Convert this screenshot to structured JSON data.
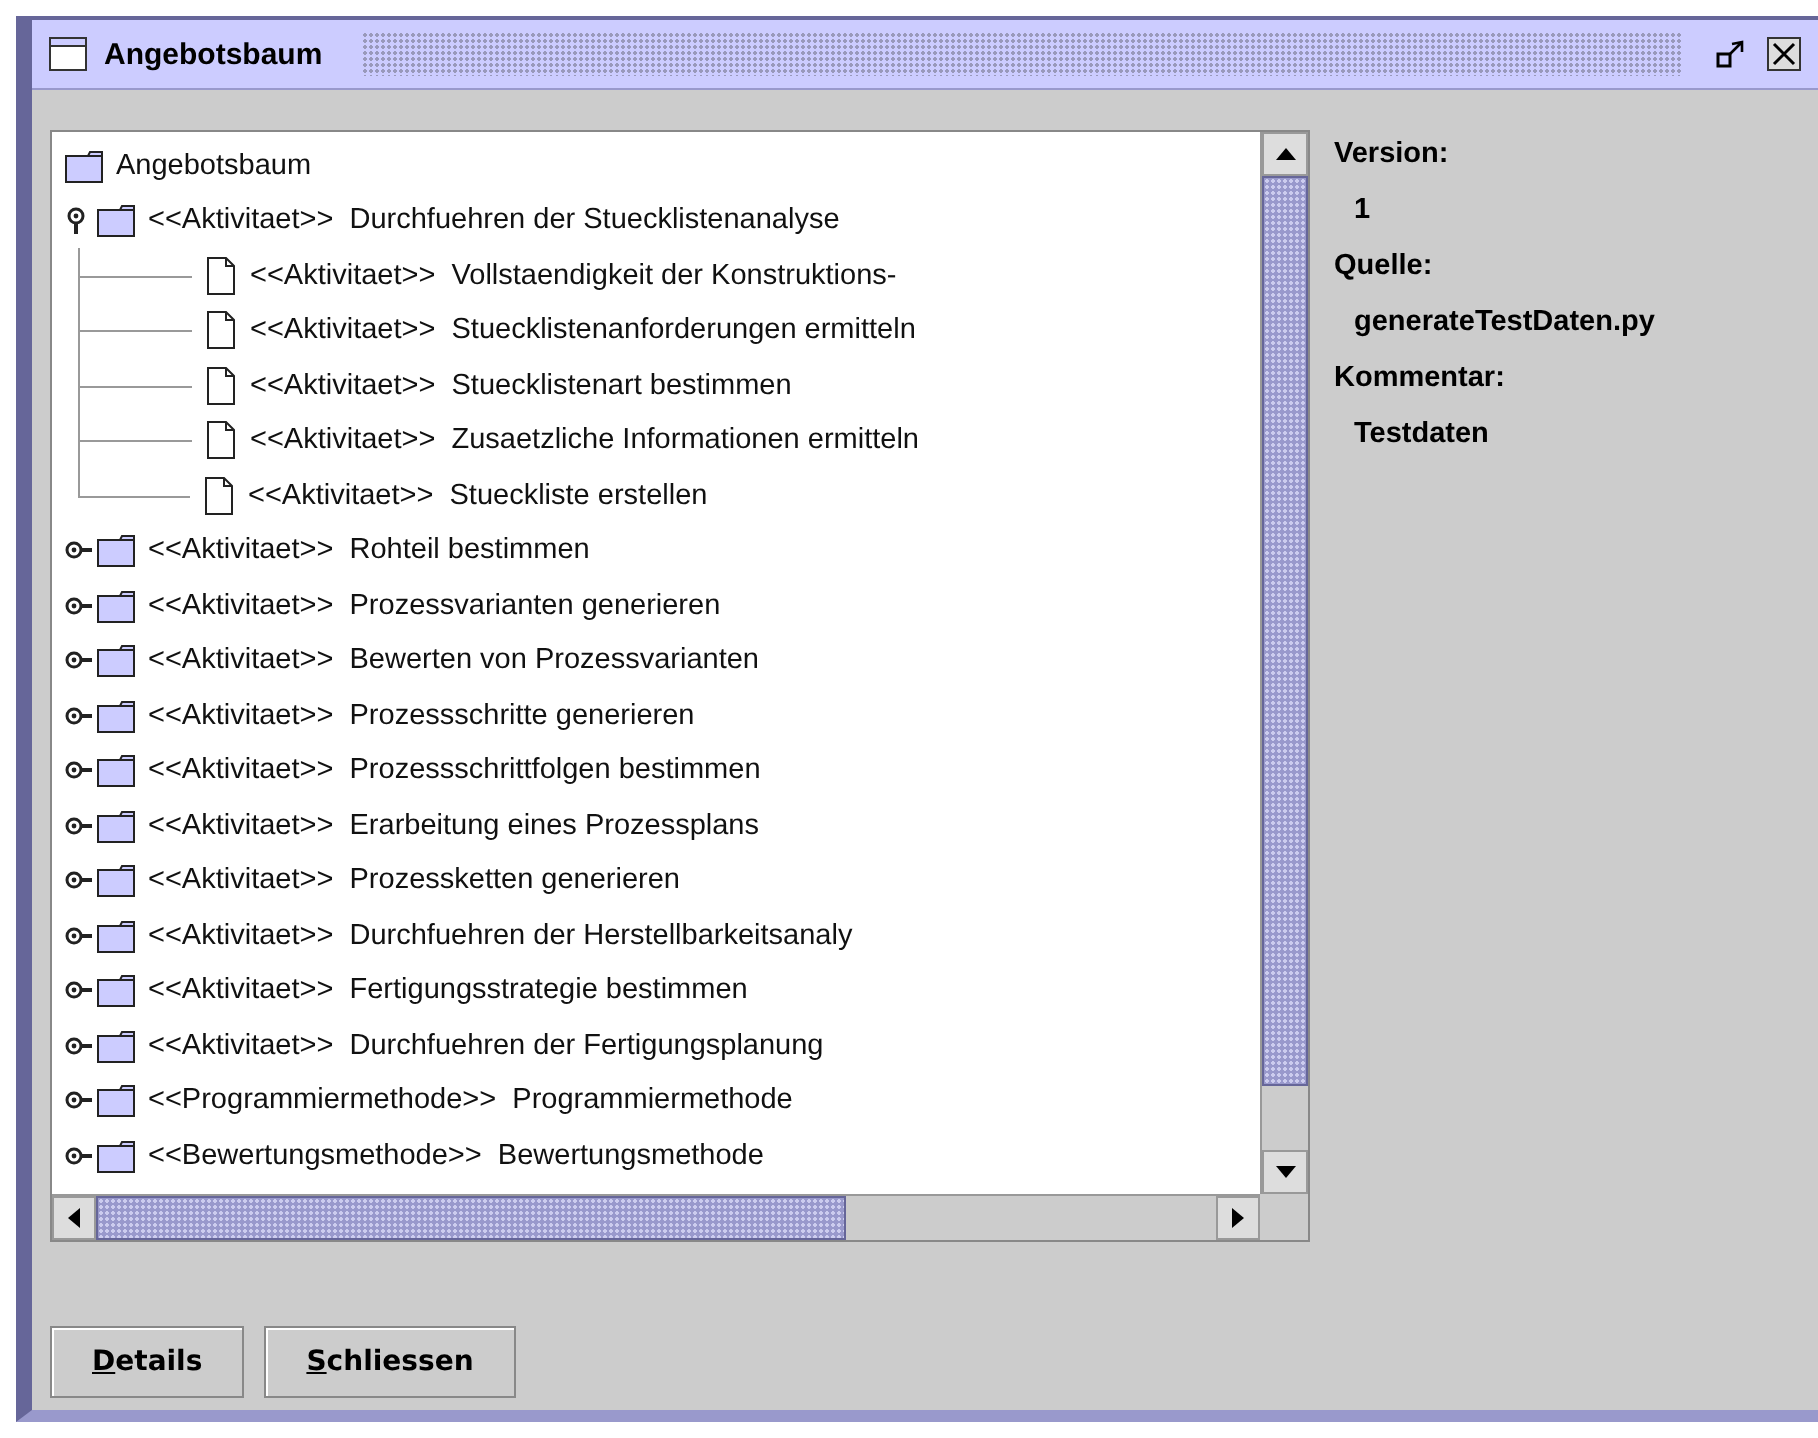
{
  "window": {
    "title": "Angebotsbaum"
  },
  "tree": {
    "label": "Angebotsbaum",
    "kind": "folder",
    "children": [
      {
        "kind": "folder",
        "stereotype": "<<Aktivitaet>>",
        "name": "Durchfuehren der Stuecklistenanalyse",
        "expanded": true,
        "children": [
          {
            "kind": "leaf",
            "stereotype": "<<Aktivitaet>>",
            "name": "Vollstaendigkeit der Konstruktions-"
          },
          {
            "kind": "leaf",
            "stereotype": "<<Aktivitaet>>",
            "name": "Stuecklistenanforderungen ermitteln"
          },
          {
            "kind": "leaf",
            "stereotype": "<<Aktivitaet>>",
            "name": "Stuecklistenart bestimmen"
          },
          {
            "kind": "leaf",
            "stereotype": "<<Aktivitaet>>",
            "name": "Zusaetzliche Informationen ermitteln"
          },
          {
            "kind": "leaf",
            "stereotype": "<<Aktivitaet>>",
            "name": "Stueckliste erstellen"
          }
        ]
      },
      {
        "kind": "folder",
        "stereotype": "<<Aktivitaet>>",
        "name": "Rohteil bestimmen",
        "expanded": false
      },
      {
        "kind": "folder",
        "stereotype": "<<Aktivitaet>>",
        "name": "Prozessvarianten generieren",
        "expanded": false
      },
      {
        "kind": "folder",
        "stereotype": "<<Aktivitaet>>",
        "name": "Bewerten von Prozessvarianten",
        "expanded": false
      },
      {
        "kind": "folder",
        "stereotype": "<<Aktivitaet>>",
        "name": "Prozessschritte generieren",
        "expanded": false
      },
      {
        "kind": "folder",
        "stereotype": "<<Aktivitaet>>",
        "name": "Prozessschrittfolgen bestimmen",
        "expanded": false
      },
      {
        "kind": "folder",
        "stereotype": "<<Aktivitaet>>",
        "name": "Erarbeitung eines Prozessplans",
        "expanded": false
      },
      {
        "kind": "folder",
        "stereotype": "<<Aktivitaet>>",
        "name": "Prozessketten generieren",
        "expanded": false
      },
      {
        "kind": "folder",
        "stereotype": "<<Aktivitaet>>",
        "name": "Durchfuehren der Herstellbarkeitsanaly",
        "expanded": false
      },
      {
        "kind": "folder",
        "stereotype": "<<Aktivitaet>>",
        "name": "Fertigungsstrategie bestimmen",
        "expanded": false
      },
      {
        "kind": "folder",
        "stereotype": "<<Aktivitaet>>",
        "name": "Durchfuehren der Fertigungsplanung",
        "expanded": false
      },
      {
        "kind": "folder",
        "stereotype": "<<Programmiermethode>>",
        "name": "Programmiermethode",
        "expanded": false
      },
      {
        "kind": "folder",
        "stereotype": "<<Bewertungsmethode>>",
        "name": "Bewertungsmethode",
        "expanded": false
      }
    ]
  },
  "properties": [
    {
      "label": "Version:",
      "value": "1"
    },
    {
      "label": "Quelle:",
      "value": "generateTestDaten.py"
    },
    {
      "label": "Kommentar:",
      "value": "Testdaten"
    }
  ],
  "buttons": [
    "Details",
    "Schliessen"
  ]
}
